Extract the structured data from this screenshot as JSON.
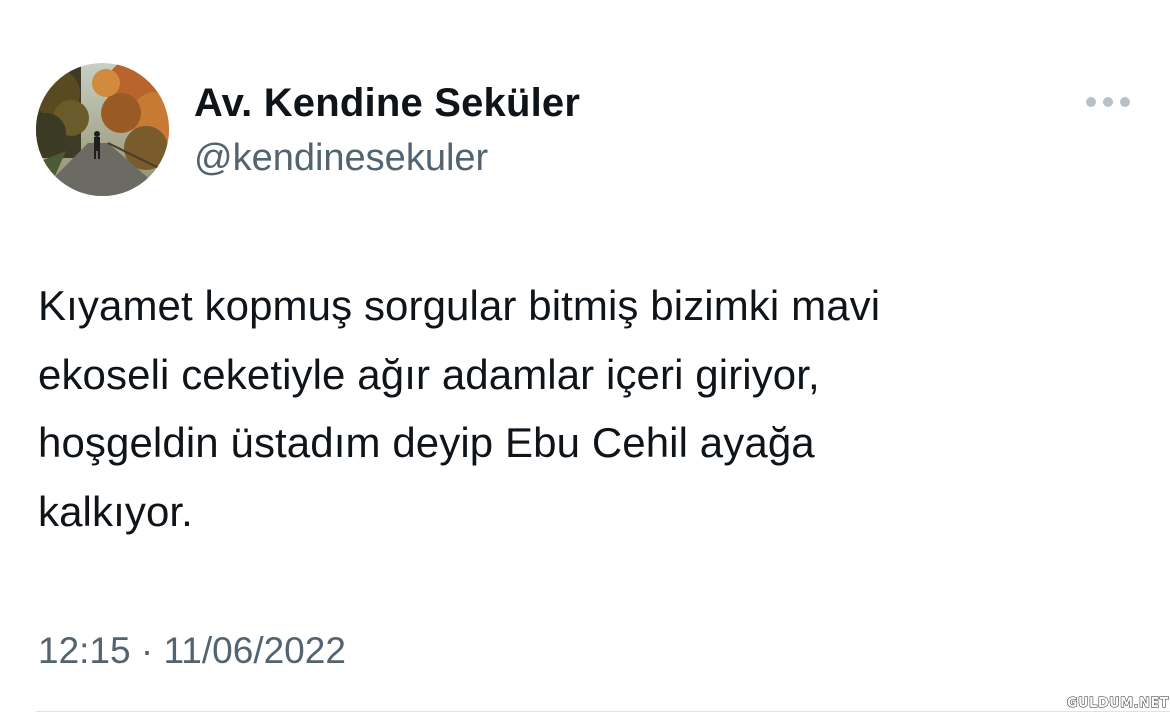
{
  "author": {
    "display_name": "Av. Kendine Seküler",
    "handle": "@kendinesekuler",
    "avatar": "avatar-photo-autumn-path"
  },
  "more_button": {
    "icon": "more-horizontal-icon"
  },
  "tweet": {
    "text": "Kıyamet kopmuş sorgular bitmiş bizimki mavi\nekoseli ceketiyle ağır adamlar içeri giriyor,\nhoşgeldin üstadım deyip Ebu Cehil ayağa\nkalkıyor.",
    "timestamp": "12:15 · 11/06/2022"
  },
  "watermark": "GULDUM.NET",
  "colors": {
    "text_primary": "#0f1419",
    "text_secondary": "#536471",
    "more_icon": "#b9c1c8",
    "divider": "#dfe3e6"
  }
}
